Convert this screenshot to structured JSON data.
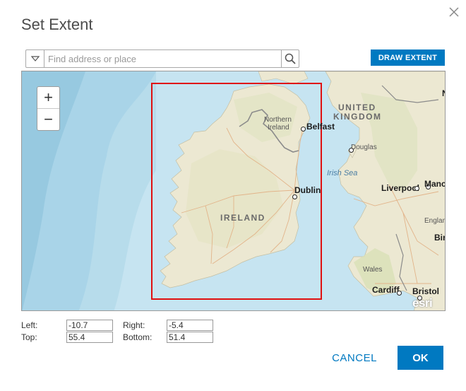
{
  "dialog": {
    "title": "Set Extent",
    "close_icon": "close-icon"
  },
  "search": {
    "placeholder": "Find address or place",
    "value": "",
    "dropdown_icon": "chevron-down-icon",
    "search_icon": "search-icon"
  },
  "toolbar": {
    "draw_extent_label": "DRAW EXTENT"
  },
  "map": {
    "zoom_in_label": "+",
    "zoom_out_label": "−",
    "attribution": "esri",
    "labels": {
      "united_kingdom_1": "UNITED",
      "united_kingdom_2": "KINGDOM",
      "northern_ireland_1": "Northern",
      "northern_ireland_2": "Ireland",
      "belfast": "Belfast",
      "douglas": "Douglas",
      "irish_sea": "Irish Sea",
      "dublin": "Dublin",
      "ireland": "IRELAND",
      "liverpool": "Liverpool",
      "manchester": "Manch",
      "england": "Englan",
      "birmingham": "Bir",
      "wales": "Wales",
      "cardiff": "Cardiff",
      "bristol": "Bristol",
      "n_edge": "N"
    },
    "colors": {
      "water": "#b7dceb",
      "water_deep": "#a3d1e6",
      "land": "#ece8d2",
      "land_green": "#d7dfb7",
      "extent_border": "#e01010",
      "road": "#e2b48a",
      "border": "#8b8b8b"
    }
  },
  "extent": {
    "left_label": "Left:",
    "left_value": "-10.7",
    "right_label": "Right:",
    "right_value": "-5.4",
    "top_label": "Top:",
    "top_value": "55.4",
    "bottom_label": "Bottom:",
    "bottom_value": "51.4"
  },
  "actions": {
    "cancel_label": "CANCEL",
    "ok_label": "OK"
  },
  "colors": {
    "accent": "#0079c1"
  }
}
